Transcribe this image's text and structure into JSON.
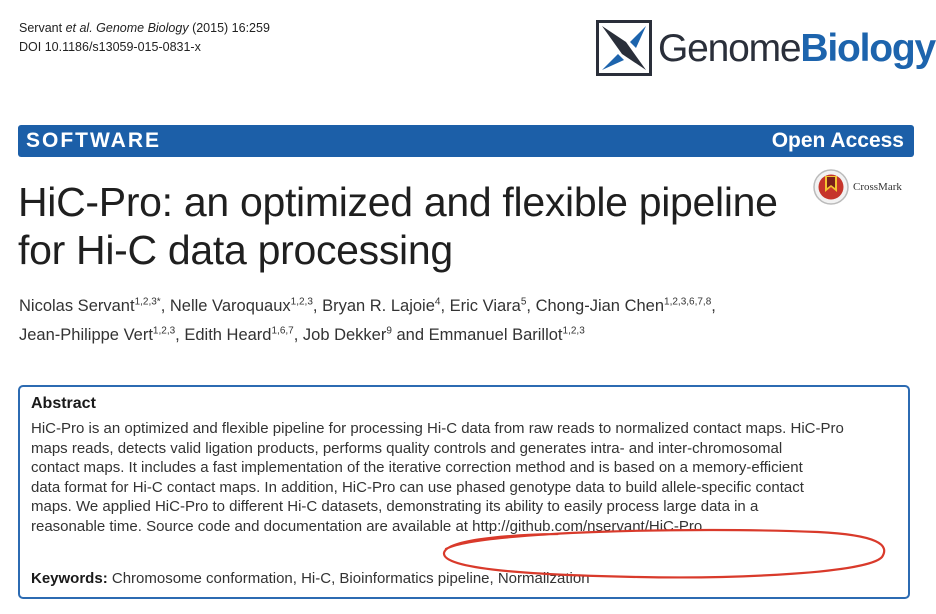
{
  "citation": {
    "authors": "Servant ",
    "etal": "et al.",
    "journal": "Genome Biology",
    "year_vol": "(2015) 16:259",
    "doi": "DOI 10.1186/s13059-015-0831-x"
  },
  "logo": {
    "word1": "Genome",
    "word2": "Biology"
  },
  "banner": {
    "section": "SOFTWARE",
    "access": "Open Access"
  },
  "crossmark": {
    "label": "CrossMark"
  },
  "title": "HiC-Pro: an optimized and flexible pipeline for Hi-C data processing",
  "authors": [
    {
      "name": "Nicolas Servant",
      "aff": "1,2,3*"
    },
    {
      "name": "Nelle Varoquaux",
      "aff": "1,2,3"
    },
    {
      "name": "Bryan R. Lajoie",
      "aff": "4"
    },
    {
      "name": "Eric Viara",
      "aff": "5"
    },
    {
      "name": "Chong-Jian Chen",
      "aff": "1,2,3,6,7,8"
    },
    {
      "name": "Jean-Philippe Vert",
      "aff": "1,2,3"
    },
    {
      "name": "Edith Heard",
      "aff": "1,6,7"
    },
    {
      "name": "Job Dekker",
      "aff": "9"
    },
    {
      "name": "Emmanuel Barillot",
      "aff": "1,2,3"
    }
  ],
  "abstract": {
    "heading": "Abstract",
    "lines": [
      "HiC-Pro is an optimized and flexible pipeline for processing Hi-C data from raw reads to normalized contact maps. HiC-Pro",
      "maps reads, detects valid ligation products, performs quality controls and generates intra- and inter-chromosomal",
      "contact maps. It includes a fast implementation of the iterative correction method and is based on a memory-efficient",
      "data format for Hi-C contact maps. In addition, HiC-Pro can use phased genotype data to build allele-specific contact",
      "maps. We applied HiC-Pro to different Hi-C datasets, demonstrating its ability to easily process large data in a",
      "reasonable time. Source code and documentation are available at http://github.com/nservant/HiC-Pro."
    ],
    "keywords_label": "Keywords:",
    "keywords": "Chromosome conformation, Hi-C, Bioinformatics pipeline, Normalization"
  },
  "colors": {
    "accent": "#1c5fa8",
    "annotation": "#d93a2b"
  }
}
